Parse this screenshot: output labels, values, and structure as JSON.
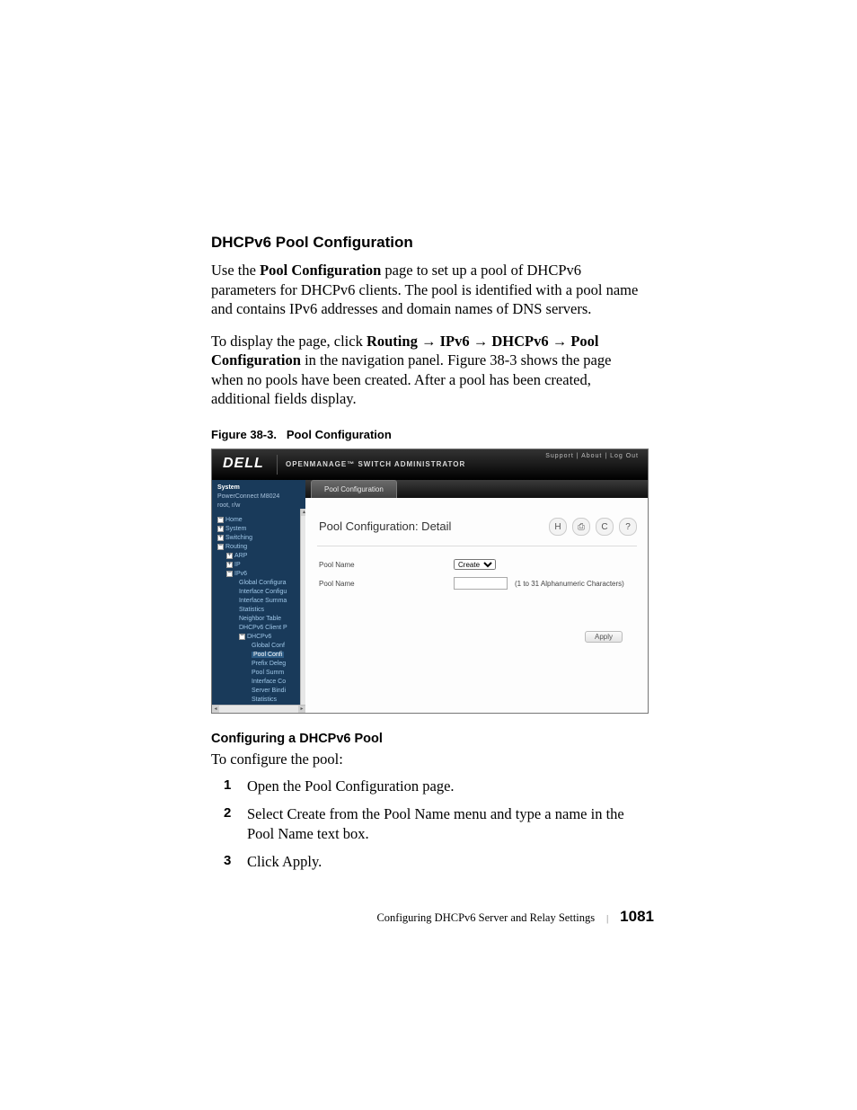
{
  "section_heading": "DHCPv6 Pool Configuration",
  "para1_pre": "Use the ",
  "para1_bold": "Pool Configuration",
  "para1_post": " page to set up a pool of DHCPv6 parameters for DHCPv6 clients. The pool is identified with a pool name and contains IPv6 addresses and domain names of DNS servers.",
  "para2_pre": "To display the page, click ",
  "nav": {
    "a": "Routing",
    "b": "IPv6",
    "c": "DHCPv6",
    "d": "Pool Configuration"
  },
  "arrow": "→",
  "para2_mid": " in the navigation panel. ",
  "para2_xref": "Figure 38-3",
  "para2_post": " shows the page when no pools have been created. After a pool has been created, additional fields display.",
  "figure_caption_label": "Figure 38-3.",
  "figure_caption_text": "Pool Configuration",
  "figure": {
    "top_title": "OPENMANAGE™ SWITCH ADMINISTRATOR",
    "logo": "DELL",
    "top_links": "Support  |  About  |  Log Out",
    "tab": "Pool Configuration",
    "main_title": "Pool Configuration: Detail",
    "hint": "",
    "row1_label": "Pool Name",
    "row1_select": "Create",
    "row2_label": "Pool Name",
    "row2_after": "(1 to 31 Alphanumeric Characters)",
    "apply": "Apply",
    "tree": {
      "sys": "System",
      "model": "PowerConnect M8024",
      "user": "root, r/w",
      "items": [
        "Home",
        "System",
        "Switching",
        "Routing",
        "ARP",
        "IP",
        "IPv6",
        "Global Configura",
        "Interface Configu",
        "Interface Summa",
        "Statistics",
        "Neighbor Table",
        "DHCPv6 Client P",
        "DHCPv6",
        "Global Conf",
        "Pool Confi",
        "Prefix Deleg",
        "Pool Summ",
        "Interface Co",
        "Server Bindi",
        "Statistics"
      ]
    }
  },
  "sub_heading": "Configuring a DHCPv6 Pool",
  "para3": "To configure the pool:",
  "steps": {
    "s1_pre": "Open the ",
    "s1_bold": "Pool Configuration",
    "s1_post": " page.",
    "s2_pre": "Select ",
    "s2_b1": "Create",
    "s2_mid1": " from the ",
    "s2_b2": "Pool Name",
    "s2_mid2": " menu and type a name in the ",
    "s2_b3": "Pool Name",
    "s2_post": " text box.",
    "s3_pre": "Click ",
    "s3_bold": "Apply",
    "s3_post": "."
  },
  "footer_chapter": "Configuring DHCPv6 Server and Relay Settings",
  "footer_page": "1081",
  "icons": {
    "save": "H",
    "print": "⎙",
    "refresh": "C",
    "help": "?"
  }
}
